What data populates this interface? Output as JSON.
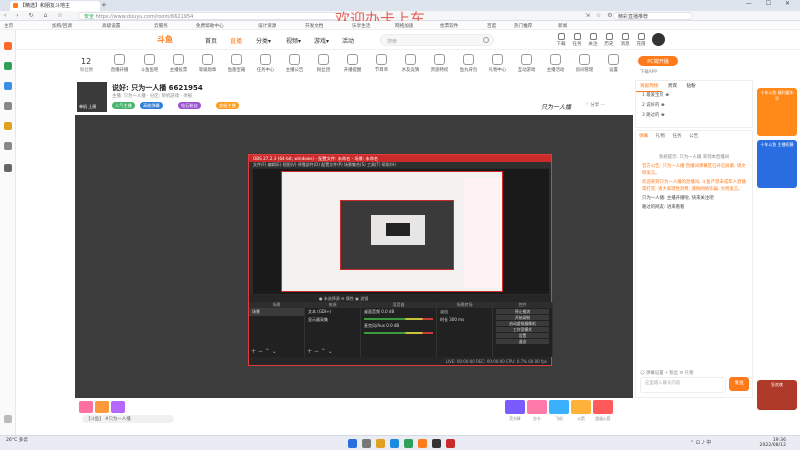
{
  "browser": {
    "tabs": [
      {
        "label": "【精选】和朋友斗地主",
        "active": true
      }
    ],
    "new_tab": "+",
    "window_controls": "— ☐ ✕",
    "nav": "‹ › ↻ ⌂ ☆",
    "url_secure": "安全",
    "url": "https://www.douyu.com/room/6621954",
    "watermark": "欢迎办卡上车",
    "toolbar_icons": "⇲ ☆ ⚙",
    "search_text": "精彩直播推荐",
    "bookmarks": [
      "主页",
      "加购/回调",
      "高级设置",
      "云服务",
      "免费帮助中心",
      "设计资源",
      "开发文档",
      "乐享生活",
      "网络加速",
      "抢票软件",
      "百度",
      "热门推荐",
      "新闻"
    ]
  },
  "site_nav": {
    "logo": "斗鱼",
    "items": [
      {
        "label": "首页",
        "active": false
      },
      {
        "label": "直播",
        "active": true
      },
      {
        "label": "分类▾",
        "active": false
      },
      {
        "label": "视频▾",
        "active": false
      },
      {
        "label": "游戏▾",
        "active": false
      },
      {
        "label": "活动",
        "active": false
      }
    ],
    "search_placeholder": "搜索",
    "top_icons": [
      "下载",
      "任务",
      "关注",
      "历史",
      "消息",
      "充值"
    ]
  },
  "icon_row": {
    "count": "12",
    "count_label": "粉丝数",
    "items": [
      "直播开播",
      "斗鱼鱼吧",
      "主播投票",
      "等级勋章",
      "鱼翅宝箱",
      "任务中心",
      "主播公告",
      "粉丝团",
      "开播提醒",
      "节目单",
      "水友竞猜",
      "贵族特权",
      "鱼丸背包",
      "礼物中心",
      "互动游戏",
      "主播活动",
      "房间管理",
      "设置",
      "直播间福利",
      "分享",
      "更多"
    ],
    "pc_pill": "PC端开播",
    "app_link": "下载APP"
  },
  "room": {
    "avatar_label": "单机 上周",
    "title": "说好: 只为一人播 6621954",
    "meta": "主播: 只为一人播   · 分区: 单机游戏   · 举报",
    "tags": [
      {
        "label": "人气主播",
        "color": "#45b36b"
      },
      {
        "label": "高能弹幕",
        "color": "#2f7fd9"
      },
      {
        "label": "钻石粉丝",
        "color": "#9b4fd1"
      },
      {
        "label": "超级主播",
        "color": "#ff9a1a"
      }
    ],
    "logo_text": "只为一人播",
    "actions": "♡ 分享 ⋯"
  },
  "obs": {
    "title": "OBS 27.2.3 (64-bit, windows) - 配置文件: 未命名 - 场景: 未命名",
    "menu": "文件(F)   编辑(E)   视图(V)   停靠部件(D)   配置文件(P)   场景集合(S)   工具(T)   帮助(H)",
    "toolbar_text": "● 未选择源       ⚙ 属性     ▣ 滤镜",
    "docks": {
      "scenes_title": "场景",
      "scenes": [
        "场景"
      ],
      "sources_title": "来源",
      "sources": [
        "文本 (GDI+)",
        "显示器采集"
      ],
      "mixer_title": "混音器",
      "mixer": [
        "桌面音频 0.0 dB",
        "麦克风/Aux 0.0 dB"
      ],
      "transitions_title": "场景转场",
      "transitions": [
        "淡出",
        "时长 300 ms"
      ],
      "controls_title": "控件",
      "controls": [
        "停止推流",
        "开始录制",
        "启动虚拟摄像机",
        "工作室模式",
        "设置",
        "退出"
      ],
      "foot": "+ − ⌃ ⌄"
    },
    "status": "LIVE: 00:00:00   REC: 00:00:00   CPU: 0.7%  60.00 fps"
  },
  "gifts": {
    "input_placeholder": "【斗鱼】 #只为一人播",
    "items": [
      "荧光棒",
      "办卡",
      "飞机",
      "火箭",
      "超级火箭",
      "嘉年华",
      "鱼丸",
      "弱鸡"
    ]
  },
  "rank": {
    "tabs": [
      {
        "label": "贡献周榜",
        "on": true
      },
      {
        "label": "贵宾",
        "on": false
      },
      {
        "label": "钻粉",
        "on": false
      }
    ],
    "rows": [
      "1  最爱宝贝  ♚",
      "2  说好的  ♚",
      "3  路过的  ♚"
    ]
  },
  "chat": {
    "tabs": [
      {
        "label": "弹幕",
        "on": true
      },
      {
        "label": "礼物",
        "on": false
      },
      {
        "label": "任务",
        "on": false
      },
      {
        "label": "公告",
        "on": false
      }
    ],
    "messages": [
      {
        "text": "系统提示: 只为一人播 来到本直播间",
        "kind": "sys"
      },
      {
        "text": "官方公告: 只为一人播 直播间弹幕区已开启屏蔽, 请文明发言。",
        "kind": "hl"
      },
      {
        "text": "欢迎来到只为一人播的直播间, 斗鱼严禁未成年人直播或打赏, 请大家理性消费, 谨防网络诈骗, 文明发言。",
        "kind": "hl"
      },
      {
        "text": "只为一人播: 主播开播啦, 快来关注吧",
        "kind": "norm"
      },
      {
        "text": "路过的网友: 进来看看",
        "kind": "norm"
      }
    ],
    "tools": "☺ 弹幕设置   ⚡ 粉丝   ✉ 礼物",
    "input_placeholder": "这里输入聊天内容",
    "send": "发送"
  },
  "banners": [
    {
      "text": "十年斗鱼 福利嘉年华",
      "bg": "#ff8a1a"
    },
    {
      "text": "十年斗鱼 主播招募",
      "bg": "#2a6de0"
    },
    {
      "text": "狂欢夜",
      "bg": "#b03a2a"
    }
  ],
  "taskbar": {
    "weather": "26°C 多云",
    "tray": "⌃  ⊡  ♪  中",
    "time": "19:36",
    "date": "2022/08/12"
  }
}
